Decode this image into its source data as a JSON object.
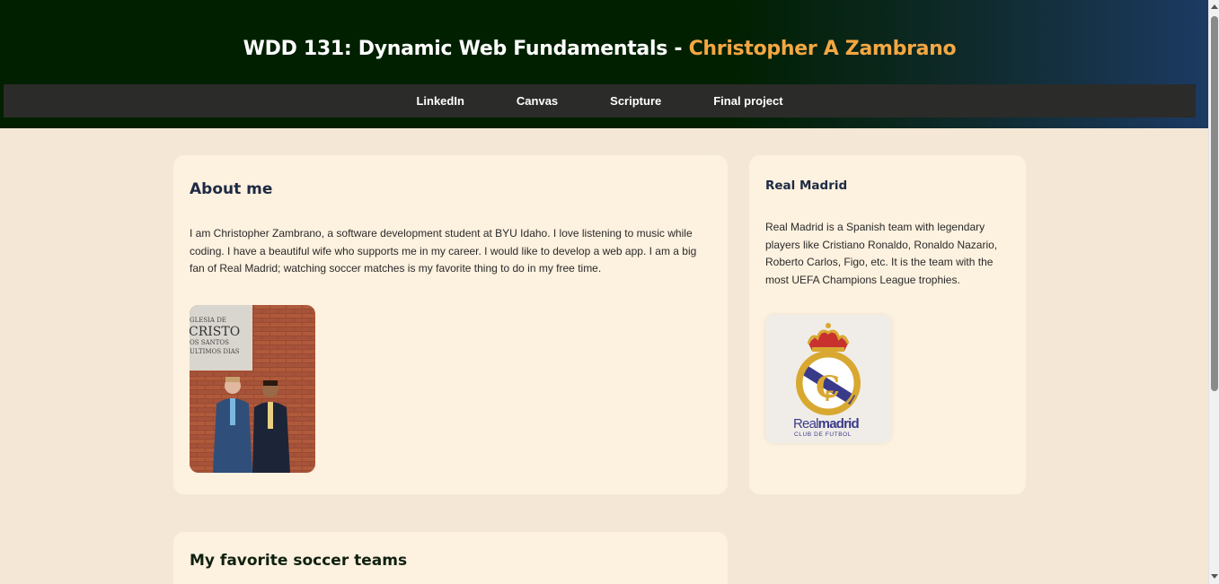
{
  "header": {
    "title_prefix": "WDD 131: Dynamic Web Fundamentals - ",
    "title_name": "Christopher A Zambrano",
    "background_start": "#002000",
    "background_end": "#1c3a63",
    "accent": "#f4a742"
  },
  "nav": {
    "items": [
      {
        "label": "LinkedIn"
      },
      {
        "label": "Canvas"
      },
      {
        "label": "Scripture"
      },
      {
        "label": "Final project"
      }
    ]
  },
  "about": {
    "heading": "About me",
    "text": "I am Christopher Zambrano, a software development student at BYU Idaho. I love listening to music while coding. I have a beautiful wife who supports me in my career. I would like to develop a web app. I am a big fan of Real Madrid; watching soccer matches is my favorite thing to do in my free time.",
    "photo": {
      "sign_lines": [
        "GLESIA DE",
        "CRISTO",
        "OS SANTOS",
        "ULTIMOS DIAS"
      ]
    }
  },
  "real_madrid": {
    "heading": "Real Madrid",
    "text": "Real Madrid is a Spanish team with legendary players like Cristiano Ronaldo, Ronaldo Nazario, Roberto Carlos, Figo, etc. It is the team with the most UEFA Champions League trophies.",
    "logo": {
      "wordmark_light": "Real",
      "wordmark_bold": "madrid",
      "tagline": "CLUB DE FUTBOL"
    }
  },
  "teams": {
    "heading": "My favorite soccer teams"
  },
  "colors": {
    "page_bg": "#f4e7d5",
    "card_bg": "#fdf1df",
    "nav_bg": "#2b2b29"
  }
}
